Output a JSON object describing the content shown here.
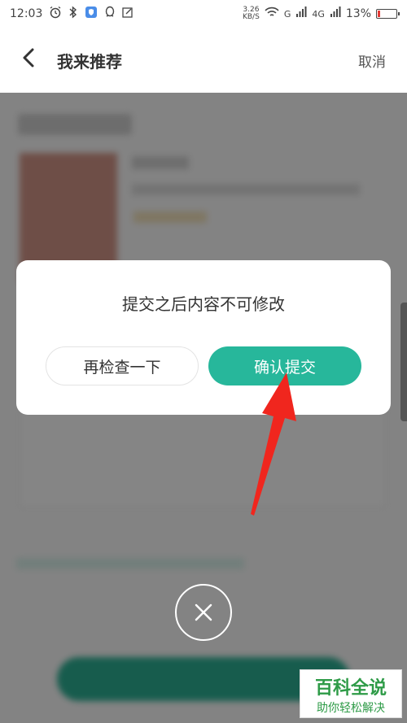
{
  "status_bar": {
    "time": "12:03",
    "speed_value": "3.26",
    "speed_unit": "KB/S",
    "signal1": "G",
    "signal2": "4G",
    "battery": "13%",
    "battery_level": 0.13
  },
  "header": {
    "back_icon": "chevron-left-icon",
    "title": "我来推荐",
    "cancel_label": "取消"
  },
  "dialog": {
    "message": "提交之后内容不可修改",
    "recheck_label": "再检查一下",
    "confirm_label": "确认提交"
  },
  "close_icon": "close-icon",
  "watermark": {
    "title": "百科全说",
    "subtitle": "助你轻松解决"
  },
  "colors": {
    "accent": "#27b79b",
    "arrow": "#f0261e",
    "watermark": "#2e9b47"
  }
}
